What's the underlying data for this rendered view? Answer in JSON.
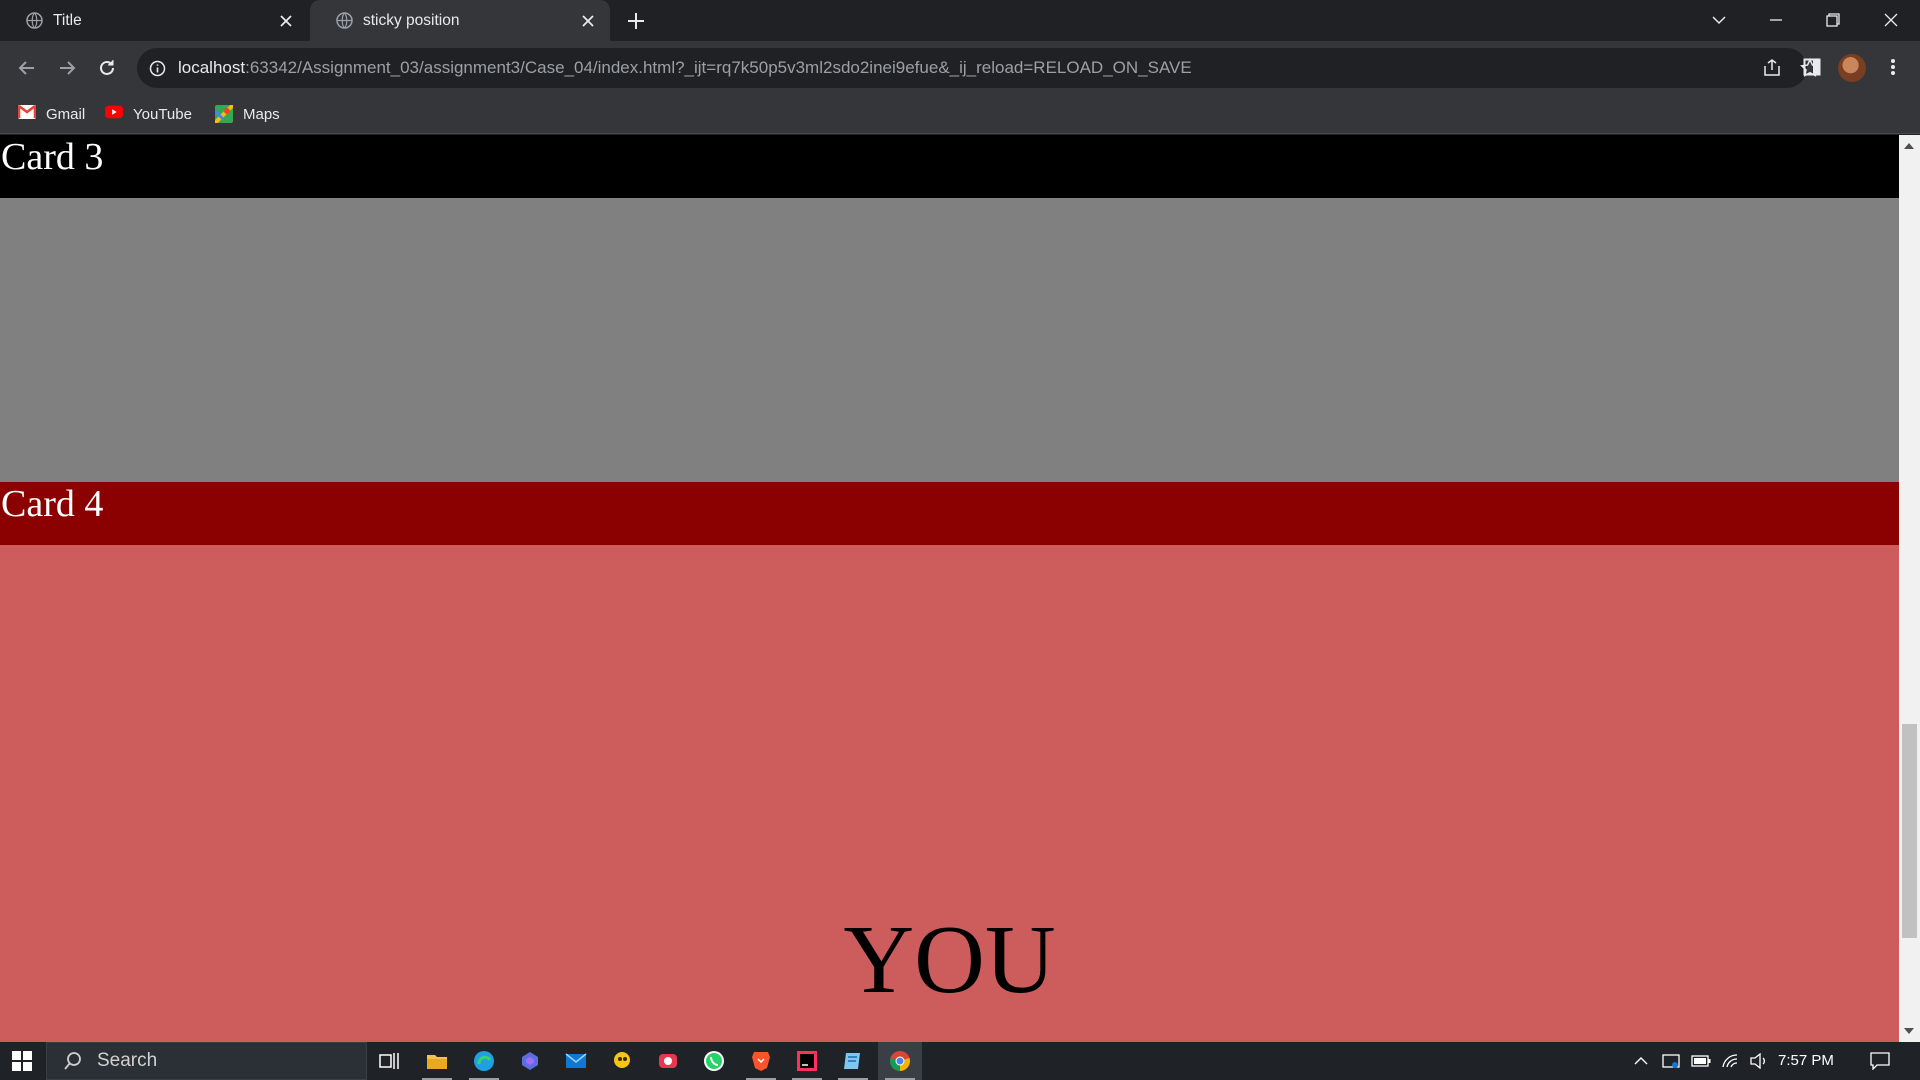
{
  "tabs": [
    {
      "title": "Title"
    },
    {
      "title": "sticky position"
    }
  ],
  "address_bar": {
    "host": "localhost",
    "path": ":63342/Assignment_03/assignment3/Case_04/index.html?_ijt=rq7k50p5v3ml2sdo2inei9efue&_ij_reload=RELOAD_ON_SAVE"
  },
  "bookmarks": [
    {
      "label": "Gmail",
      "icon": "gmail-icon"
    },
    {
      "label": "YouTube",
      "icon": "youtube-icon"
    },
    {
      "label": "Maps",
      "icon": "maps-icon"
    }
  ],
  "page": {
    "card3_title": "Card 3",
    "card4_title": "Card 4",
    "body_text": "YOU",
    "colors": {
      "card3_header": "#000000",
      "card3_body": "#808080",
      "card4_header": "#8b0000",
      "card4_body": "#cd5c5c"
    }
  },
  "taskbar": {
    "search_placeholder": "Search",
    "clock": "7:57 PM"
  }
}
